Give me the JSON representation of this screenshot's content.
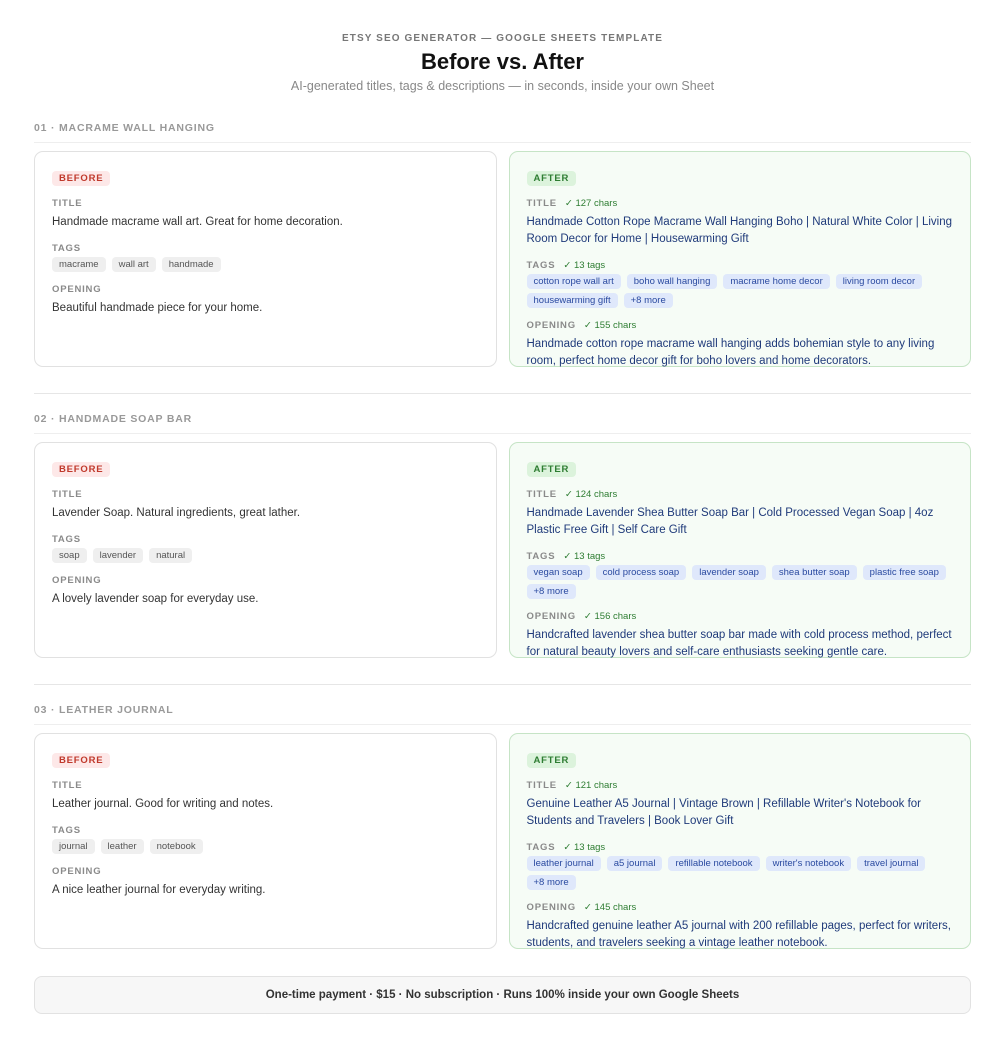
{
  "header": {
    "eyebrow": "ETSY SEO GENERATOR — GOOGLE SHEETS TEMPLATE",
    "title": "Before vs. After",
    "subtitle": "AI-generated titles, tags & descriptions — in seconds, inside your own Sheet"
  },
  "labels": {
    "before_badge": "BEFORE",
    "after_badge": "AFTER",
    "title": "TITLE",
    "tags": "TAGS",
    "opening": "OPENING"
  },
  "sections": [
    {
      "heading": "01 · MACRAME WALL HANGING",
      "before": {
        "title": "Handmade macrame wall art. Great for home decoration.",
        "tags": [
          "macrame",
          "wall art",
          "handmade"
        ],
        "opening": "Beautiful handmade piece for your home."
      },
      "after": {
        "title_check": "✓ 127 chars",
        "title": "Handmade Cotton Rope Macrame Wall Hanging Boho | Natural White Color | Living Room Decor for Home | Housewarming Gift",
        "tags_check": "✓ 13 tags",
        "tags": [
          "cotton rope wall art",
          "boho wall hanging",
          "macrame home decor",
          "living room decor",
          "housewarming gift",
          "+8 more"
        ],
        "opening_check": "✓ 155 chars",
        "opening": "Handmade cotton rope macrame wall hanging adds bohemian style to any living room, perfect home decor gift for boho lovers and home decorators."
      }
    },
    {
      "heading": "02 · HANDMADE SOAP BAR",
      "before": {
        "title": "Lavender Soap. Natural ingredients, great lather.",
        "tags": [
          "soap",
          "lavender",
          "natural"
        ],
        "opening": "A lovely lavender soap for everyday use."
      },
      "after": {
        "title_check": "✓ 124 chars",
        "title": "Handmade Lavender Shea Butter Soap Bar | Cold Processed Vegan Soap | 4oz Plastic Free Gift | Self Care Gift",
        "tags_check": "✓ 13 tags",
        "tags": [
          "vegan soap",
          "cold process soap",
          "lavender soap",
          "shea butter soap",
          "plastic free soap",
          "+8 more"
        ],
        "opening_check": "✓ 156 chars",
        "opening": "Handcrafted lavender shea butter soap bar made with cold process method, perfect for natural beauty lovers and self-care enthusiasts seeking gentle care."
      }
    },
    {
      "heading": "03 · LEATHER JOURNAL",
      "before": {
        "title": "Leather journal. Good for writing and notes.",
        "tags": [
          "journal",
          "leather",
          "notebook"
        ],
        "opening": "A nice leather journal for everyday writing."
      },
      "after": {
        "title_check": "✓ 121 chars",
        "title": "Genuine Leather A5 Journal | Vintage Brown | Refillable Writer's Notebook for Students and Travelers | Book Lover Gift",
        "tags_check": "✓ 13 tags",
        "tags": [
          "leather journal",
          "a5 journal",
          "refillable notebook",
          "writer's notebook",
          "travel journal",
          "+8 more"
        ],
        "opening_check": "✓ 145 chars",
        "opening": "Handcrafted genuine leather A5 journal with 200 refillable pages, perfect for writers, students, and travelers seeking a vintage leather notebook."
      }
    }
  ],
  "footer": {
    "text": "One-time payment · $15 · No subscription · Runs 100% inside your own Google Sheets"
  },
  "colors": {
    "before_accent": "#c0392b",
    "after_accent": "#2e7d32",
    "after_text": "#1f3a7a",
    "tag_blue": "#2a4aa0"
  }
}
